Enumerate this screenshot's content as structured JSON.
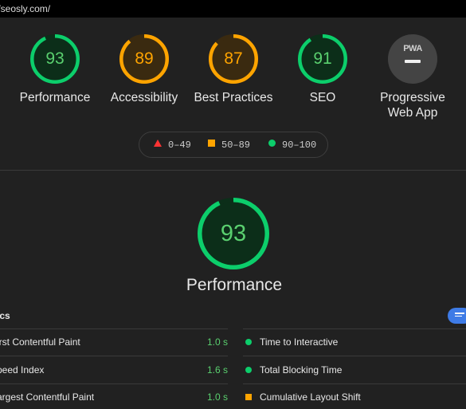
{
  "url": "//seosly.com/",
  "categories": [
    {
      "label": "Performance",
      "score": "93",
      "fraction": 0.93,
      "color": "#0cce6b",
      "text_color": "#5ad06f",
      "track": "#0c2e19"
    },
    {
      "label": "Accessibility",
      "score": "89",
      "fraction": 0.89,
      "color": "#ffa400",
      "text_color": "#ffa400",
      "track": "#3a2a10"
    },
    {
      "label": "Best Practices",
      "score": "87",
      "fraction": 0.87,
      "color": "#ffa400",
      "text_color": "#ffa400",
      "track": "#3a2a10"
    },
    {
      "label": "SEO",
      "score": "91",
      "fraction": 0.91,
      "color": "#0cce6b",
      "text_color": "#5ad06f",
      "track": "#0c2e19"
    }
  ],
  "pwa": {
    "label_line1": "Progressive",
    "label_line2": "Web App",
    "badge_text": "PWA"
  },
  "legend": {
    "fail": "0–49",
    "average": "50–89",
    "pass": "90–100"
  },
  "main": {
    "score": "93",
    "fraction": 0.93,
    "title": "Performance"
  },
  "metrics": {
    "heading": "ics",
    "left": [
      {
        "label": "irst Contentful Paint",
        "value": "1.0 s"
      },
      {
        "label": "peed Index",
        "value": "1.6 s"
      },
      {
        "label": "argest Contentful Paint",
        "value": "1.0 s"
      }
    ],
    "right": [
      {
        "label": "Time to Interactive",
        "status": "pass"
      },
      {
        "label": "Total Blocking Time",
        "status": "pass"
      },
      {
        "label": "Cumulative Layout Shift",
        "status": "average"
      }
    ]
  }
}
